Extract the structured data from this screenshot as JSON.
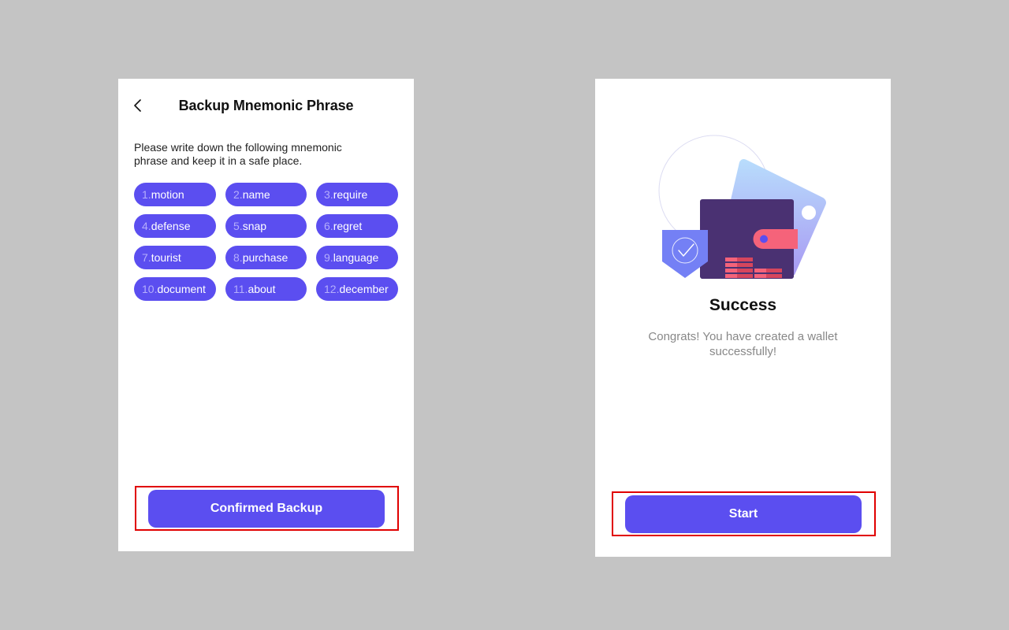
{
  "backup_screen": {
    "title": "Backup Mnemonic Phrase",
    "instruction": "Please write down the following mnemonic phrase and keep it in a safe place.",
    "back_icon": "chevron-left-icon",
    "phrase": [
      {
        "num": "1.",
        "word": "motion"
      },
      {
        "num": "2.",
        "word": "name"
      },
      {
        "num": "3.",
        "word": "require"
      },
      {
        "num": "4.",
        "word": "defense"
      },
      {
        "num": "5.",
        "word": "snap"
      },
      {
        "num": "6.",
        "word": "regret"
      },
      {
        "num": "7.",
        "word": "tourist"
      },
      {
        "num": "8.",
        "word": "purchase"
      },
      {
        "num": "9.",
        "word": "language"
      },
      {
        "num": "10.",
        "word": "document"
      },
      {
        "num": "11.",
        "word": "about"
      },
      {
        "num": "12.",
        "word": "december"
      }
    ],
    "confirm_button": "Confirmed Backup"
  },
  "success_screen": {
    "illustration": "wallet-shield-illustration",
    "title": "Success",
    "message": "Congrats! You have created a wallet successfully!",
    "start_button": "Start"
  },
  "colors": {
    "accent": "#5b4ef0",
    "highlight_frame": "#e00000",
    "background": "#c4c4c4",
    "wallet": "#4a3172",
    "wallet_strap": "#f5637a",
    "shield": "#7480f5"
  }
}
